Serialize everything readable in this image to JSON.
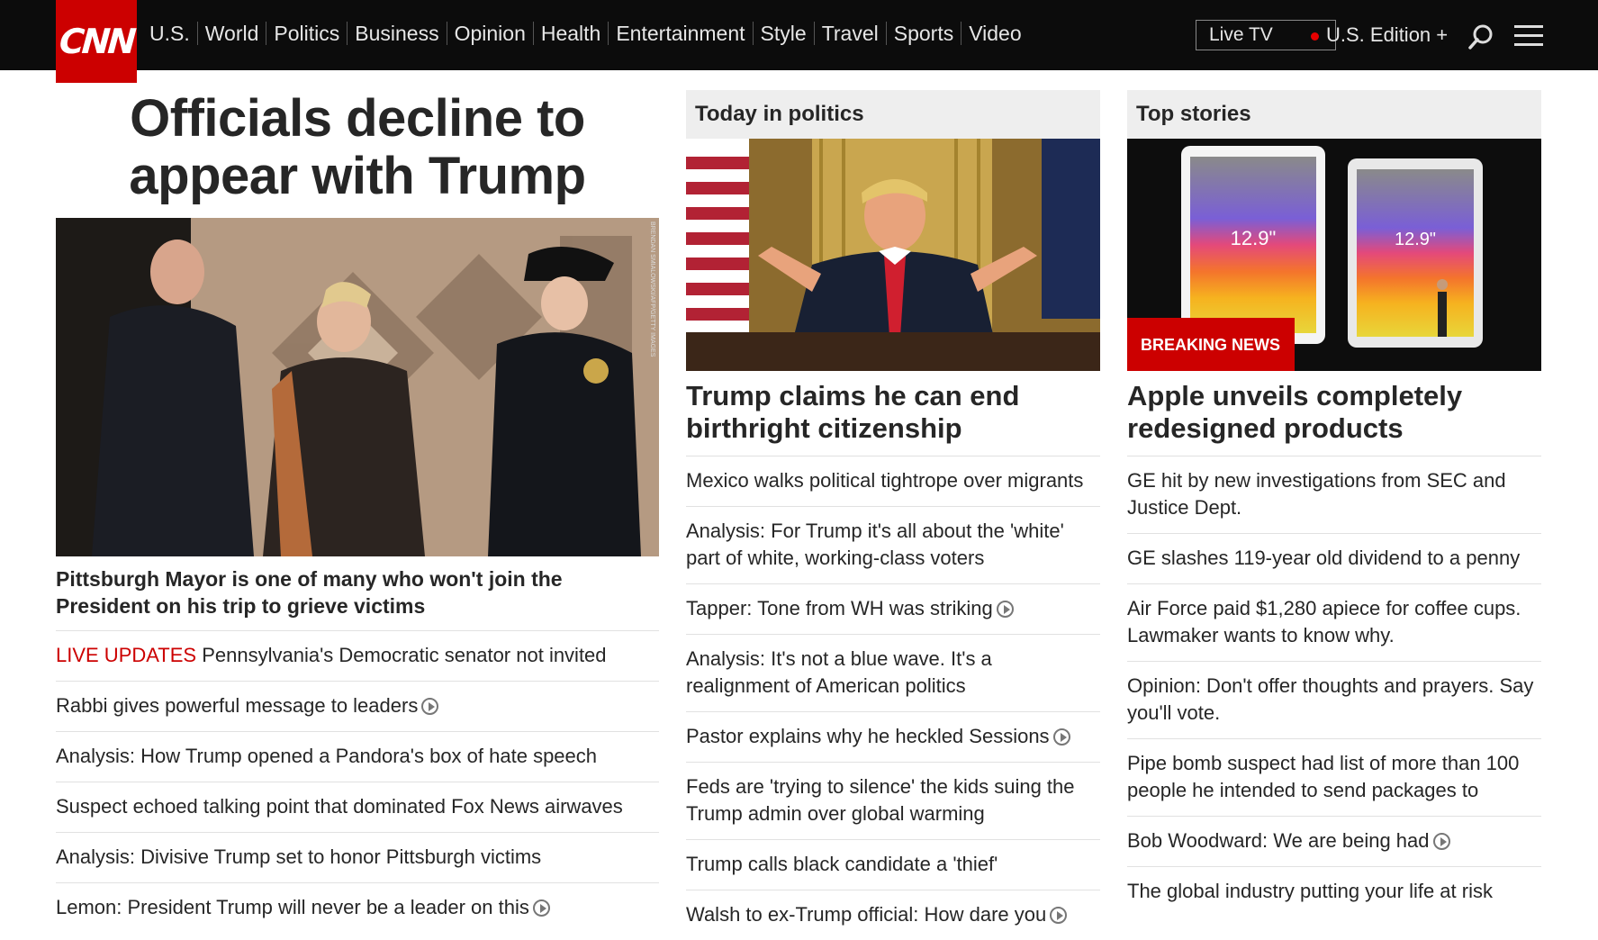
{
  "header": {
    "logo": "CNN",
    "nav": [
      "U.S.",
      "World",
      "Politics",
      "Business",
      "Opinion",
      "Health",
      "Entertainment",
      "Style",
      "Travel",
      "Sports",
      "Video"
    ],
    "live_tv": "Live TV",
    "edition": "U.S. Edition +"
  },
  "lead": {
    "title": "Officials decline to appear with Trump",
    "image_credit": "BRENDAN SMIALOWSKI/AFP/GETTY IMAGES",
    "headline": "Pittsburgh Mayor is one of many who won't join the President on his trip to grieve victims",
    "live_label": "LIVE UPDATES",
    "live_text": "Pennsylvania's Democratic senator not invited",
    "links": [
      {
        "text": "Rabbi gives powerful message to leaders",
        "video": true
      },
      {
        "text": "Analysis: How Trump opened a Pandora's box of hate speech",
        "video": false
      },
      {
        "text": "Suspect echoed talking point that dominated Fox News airwaves",
        "video": false
      },
      {
        "text": "Analysis: Divisive Trump set to honor Pittsburgh victims",
        "video": false
      },
      {
        "text": "Lemon: President Trump will never be a leader on this",
        "video": true
      }
    ]
  },
  "politics": {
    "section": "Today in politics",
    "headline": "Trump claims he can end birthright citizenship",
    "links": [
      {
        "text": "Mexico walks political tightrope over migrants",
        "video": false
      },
      {
        "text": "Analysis: For Trump it's all about the 'white' part of white, working-class voters",
        "video": false
      },
      {
        "text": "Tapper: Tone from WH was striking",
        "video": true
      },
      {
        "text": "Analysis: It's not a blue wave. It's a realignment of American politics",
        "video": false
      },
      {
        "text": "Pastor explains why he heckled Sessions",
        "video": true
      },
      {
        "text": "Feds are 'trying to silence' the kids suing the Trump admin over global warming",
        "video": false
      },
      {
        "text": "Trump calls black candidate a 'thief'",
        "video": false
      },
      {
        "text": "Walsh to ex-Trump official: How dare you",
        "video": true
      }
    ]
  },
  "top": {
    "section": "Top stories",
    "badge": "BREAKING NEWS",
    "ipad_label_1": "12.9\"",
    "ipad_label_2": "12.9\"",
    "headline": "Apple unveils completely redesigned products",
    "links": [
      {
        "text": "GE hit by new investigations from SEC and Justice Dept.",
        "video": false
      },
      {
        "text": "GE slashes 119-year old dividend to a penny",
        "video": false
      },
      {
        "text": "Air Force paid $1,280 apiece for coffee cups. Lawmaker wants to know why.",
        "video": false
      },
      {
        "text": "Opinion: Don't offer thoughts and prayers. Say you'll vote.",
        "video": false
      },
      {
        "text": "Pipe bomb suspect had list of more than 100 people he intended to send packages to",
        "video": false
      },
      {
        "text": "Bob Woodward: We are being had",
        "video": true
      },
      {
        "text": "The global industry putting your life at risk",
        "video": false
      }
    ]
  },
  "colors": {
    "brand": "#cc0000",
    "bar": "#0c0c0c",
    "section_bg": "#eeeeee"
  }
}
